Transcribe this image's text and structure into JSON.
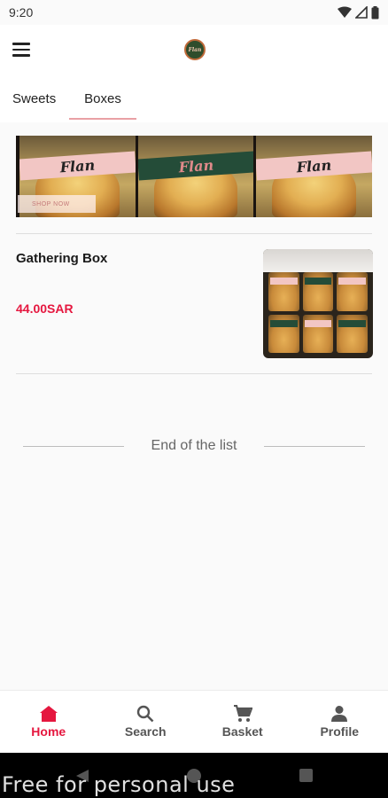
{
  "status_bar": {
    "time": "9:20",
    "icons": [
      "wifi-icon",
      "signal-icon",
      "battery-icon"
    ]
  },
  "app_bar": {
    "menu_icon": "hamburger-menu-icon",
    "logo_text": "Flan"
  },
  "tabs": [
    {
      "label": "Sweets",
      "selected": false
    },
    {
      "label": "Boxes",
      "selected": true
    }
  ],
  "banner": {
    "tiles": [
      {
        "brand": "Flan",
        "band_color": "#f2c6c4"
      },
      {
        "brand": "Flan",
        "band_color": "#244c38"
      },
      {
        "brand": "Flan",
        "band_color": "#f2c6c4"
      }
    ],
    "cta": "SHOP NOW"
  },
  "products": [
    {
      "name": "Gathering Box",
      "price": "44.00SAR"
    }
  ],
  "end_of_list": "End of the list",
  "bottom_nav": [
    {
      "label": "Home",
      "icon": "home-icon",
      "active": true
    },
    {
      "label": "Search",
      "icon": "search-icon",
      "active": false
    },
    {
      "label": "Basket",
      "icon": "cart-icon",
      "active": false
    },
    {
      "label": "Profile",
      "icon": "person-icon",
      "active": false
    }
  ],
  "watermark": "Free for personal use",
  "colors": {
    "accent": "#e5173f",
    "tab_indicator": "#e9a0a5",
    "logo_green": "#2f4d2c"
  }
}
